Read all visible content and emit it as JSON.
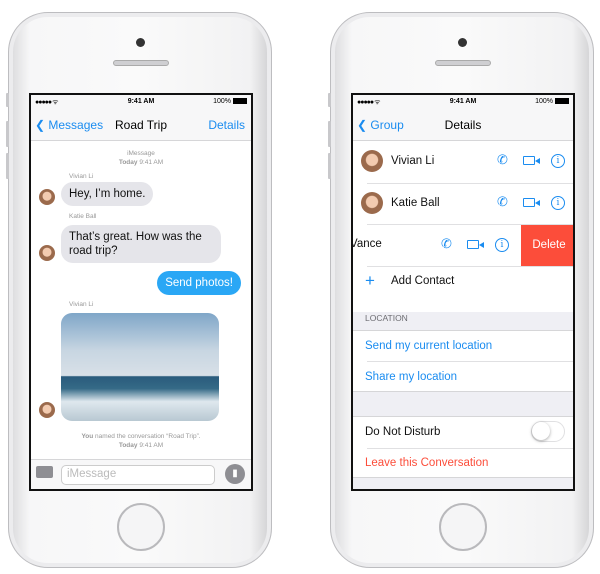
{
  "status": {
    "signal": "●●●●● ᯤ",
    "time": "9:41 AM",
    "battery": "100%"
  },
  "left": {
    "nav": {
      "back": "Messages",
      "title": "Road Trip",
      "right": "Details"
    },
    "header": {
      "service": "iMessage",
      "today": "Today",
      "time": "9:41 AM"
    },
    "messages": [
      {
        "sender": "Vivian Li",
        "text": "Hey, I’m home."
      },
      {
        "sender": "Katie Ball",
        "text": "That’s great. How was the road trip?"
      },
      {
        "sender": "me",
        "text": "Send photos!"
      },
      {
        "sender": "Vivian Li",
        "text": ""
      }
    ],
    "notice": {
      "you": "You",
      "text": "named the conversation “Road Trip”.",
      "today": "Today",
      "time": "9:41 AM"
    },
    "input_placeholder": "iMessage"
  },
  "right": {
    "nav": {
      "back": "Group",
      "title": "Details"
    },
    "contacts": [
      {
        "name": "Vivian Li"
      },
      {
        "name": "Katie Ball"
      },
      {
        "name": "Vance"
      }
    ],
    "delete": "Delete",
    "add_contact": "Add Contact",
    "location_header": "LOCATION",
    "send_location": "Send my current location",
    "share_location": "Share my location",
    "dnd": "Do Not Disturb",
    "dnd_on": false,
    "leave": "Leave this Conversation"
  },
  "colors": {
    "accent": "#1a8cf0",
    "delete": "#fc4d3a",
    "bubble_me": "#2aa7f5"
  }
}
